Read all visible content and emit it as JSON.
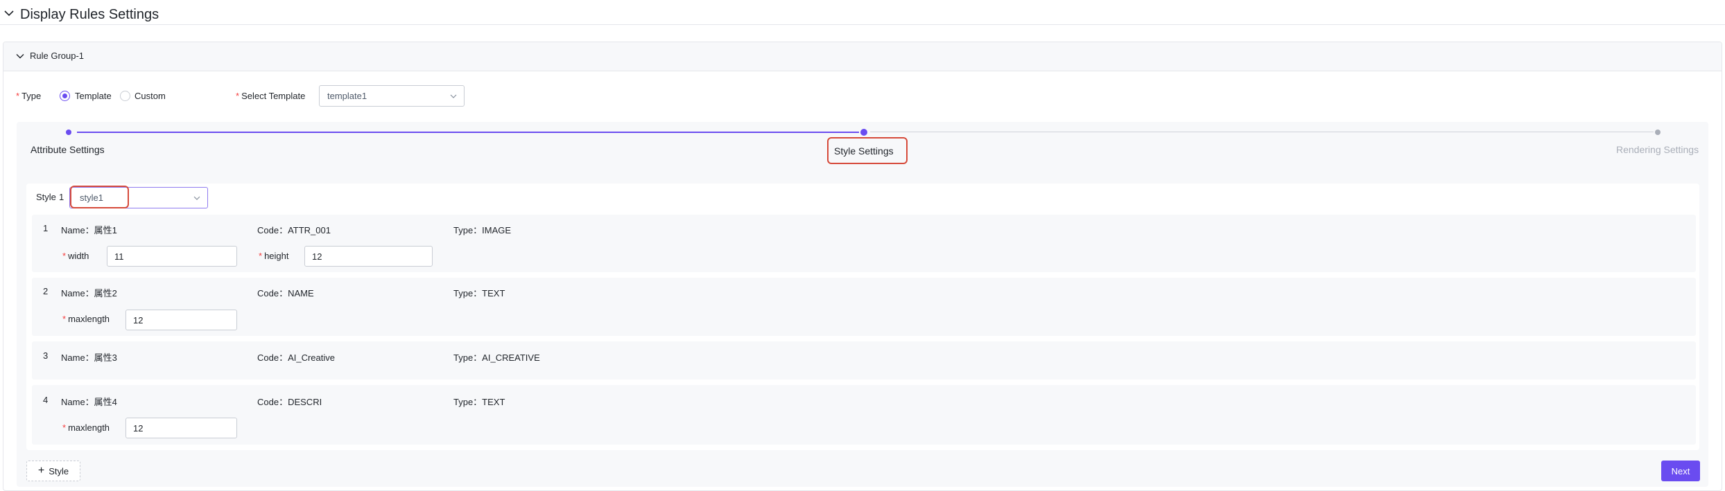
{
  "section": {
    "title": "Display Rules Settings"
  },
  "rule_group": {
    "title": "Rule Group-1"
  },
  "type_field": {
    "label": "Type",
    "options": [
      {
        "label": "Template",
        "checked": true
      },
      {
        "label": "Custom",
        "checked": false
      }
    ]
  },
  "select_template": {
    "label": "Select Template",
    "value": "template1"
  },
  "steps": [
    {
      "label": "Attribute Settings",
      "state": "done"
    },
    {
      "label": "Style Settings",
      "state": "active"
    },
    {
      "label": "Rendering Settings",
      "state": "pending"
    }
  ],
  "style": {
    "label": "Style",
    "number": "1",
    "value": "style1"
  },
  "attributes": [
    {
      "index": "1",
      "name": "Name：属性1",
      "code": "Code：ATTR_001",
      "type": "Type：IMAGE",
      "fields": [
        {
          "label": "width",
          "value": "11"
        },
        {
          "label": "height",
          "value": "12"
        }
      ]
    },
    {
      "index": "2",
      "name": "Name：属性2",
      "code": "Code：NAME",
      "type": "Type：TEXT",
      "fields": [
        {
          "label": "maxlength",
          "value": "12"
        }
      ]
    },
    {
      "index": "3",
      "name": "Name：属性3",
      "code": "Code：AI_Creative",
      "type": "Type：AI_CREATIVE",
      "fields": []
    },
    {
      "index": "4",
      "name": "Name：属性4",
      "code": "Code：DESCRI",
      "type": "Type：TEXT",
      "fields": [
        {
          "label": "maxlength",
          "value": "12"
        }
      ]
    }
  ],
  "buttons": {
    "add_style": "Style",
    "next": "Next"
  },
  "colors": {
    "accent": "#6a4cf0",
    "required": "#f53f3f",
    "highlight": "#d64a3a"
  }
}
